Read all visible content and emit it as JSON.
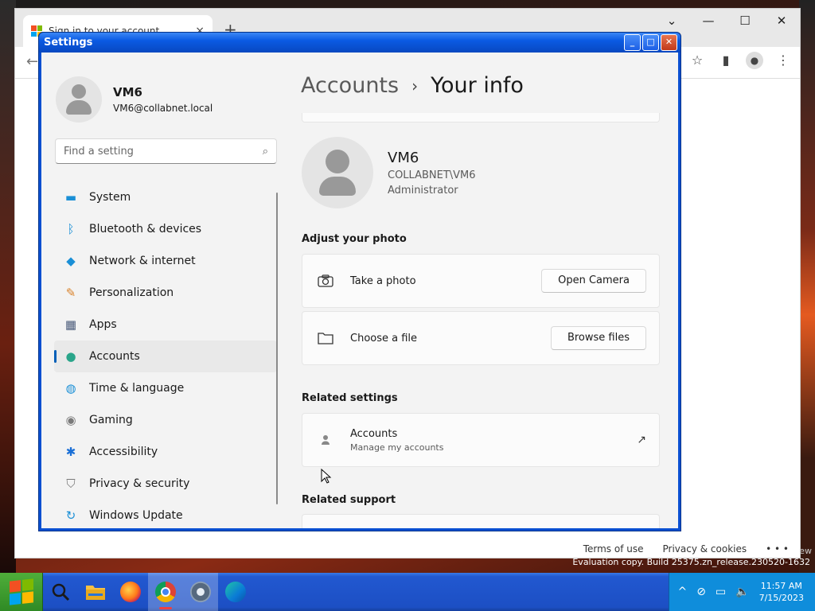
{
  "browser": {
    "tab_title": "Sign in to your account",
    "close_glyph": "×",
    "new_tab_glyph": "+",
    "back_glyph": "←",
    "window_controls": {
      "chevron": "⌄",
      "minimize": "—",
      "maximize": "☐",
      "close": "✕"
    },
    "toolbar_icons": {
      "star": "☆",
      "sidepanel": "▮",
      "profile": "●",
      "menu": "⋮"
    },
    "footer_links": [
      "Terms of use",
      "Privacy & cookies",
      "• • •"
    ]
  },
  "system_watermark": {
    "line": "Evaluation copy. Build 25375.zn_release.230520-1632",
    "edge": "ew"
  },
  "settings": {
    "window_title": "Settings",
    "window_buttons": {
      "minimize": "_",
      "maximize": "□",
      "close": "✕"
    },
    "profile": {
      "name": "VM6",
      "email": "VM6@collabnet.local"
    },
    "search": {
      "placeholder": "Find a setting",
      "icon": "⌕"
    },
    "nav": [
      {
        "label": "System",
        "icon": "system-icon",
        "glyph": "▬",
        "color": "#1a8fd6"
      },
      {
        "label": "Bluetooth & devices",
        "icon": "bluetooth-icon",
        "glyph": "ᛒ",
        "color": "#1a8fd6"
      },
      {
        "label": "Network & internet",
        "icon": "wifi-icon",
        "glyph": "◆",
        "color": "#1a8fd6"
      },
      {
        "label": "Personalization",
        "icon": "brush-icon",
        "glyph": "✎",
        "color": "#d9822b"
      },
      {
        "label": "Apps",
        "icon": "apps-icon",
        "glyph": "▦",
        "color": "#4a5b7a"
      },
      {
        "label": "Accounts",
        "icon": "accounts-icon",
        "glyph": "●",
        "color": "#2aa58a"
      },
      {
        "label": "Time & language",
        "icon": "globe-icon",
        "glyph": "◍",
        "color": "#1a8fd6"
      },
      {
        "label": "Gaming",
        "icon": "gamepad-icon",
        "glyph": "◉",
        "color": "#7a7a7a"
      },
      {
        "label": "Accessibility",
        "icon": "accessibility-icon",
        "glyph": "✱",
        "color": "#1a6fd6"
      },
      {
        "label": "Privacy & security",
        "icon": "shield-icon",
        "glyph": "⛉",
        "color": "#7a7a7a"
      },
      {
        "label": "Windows Update",
        "icon": "update-icon",
        "glyph": "↻",
        "color": "#1a8fd6"
      }
    ],
    "active_nav_index": 5,
    "breadcrumb": {
      "parent": "Accounts",
      "separator": "›",
      "current": "Your info"
    },
    "user": {
      "name": "VM6",
      "account": "COLLABNET\\VM6",
      "role": "Administrator"
    },
    "adjust_photo": {
      "title": "Adjust your photo",
      "take_photo": {
        "label": "Take a photo",
        "button": "Open Camera"
      },
      "choose_file": {
        "label": "Choose a file",
        "button": "Browse files"
      }
    },
    "related_settings": {
      "title": "Related settings",
      "accounts": {
        "label": "Accounts",
        "sub": "Manage my accounts",
        "link_glyph": "↗"
      }
    },
    "related_support": {
      "title": "Related support"
    }
  },
  "taskbar": {
    "apps": [
      "start-button",
      "search-app",
      "file-explorer",
      "firefox",
      "chrome",
      "settings",
      "edge"
    ],
    "tray_icons": {
      "chevron": "^",
      "network_off": "⊘",
      "display": "▭",
      "volume": "🔈"
    },
    "time": "11:57 AM",
    "date": "7/15/2023"
  }
}
